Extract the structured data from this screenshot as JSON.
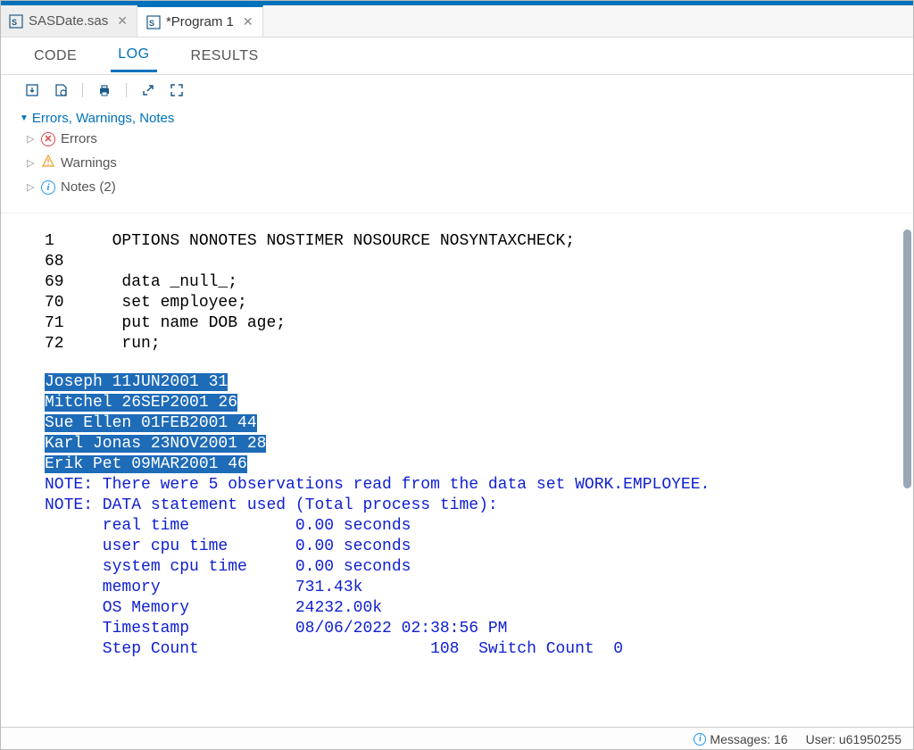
{
  "file_tabs": [
    {
      "label": "SASDate.sas",
      "active": false
    },
    {
      "label": "*Program 1",
      "active": true
    }
  ],
  "view_tabs": {
    "code": "CODE",
    "log": "LOG",
    "results": "RESULTS"
  },
  "filters": {
    "header": "Errors, Warnings, Notes",
    "errors": "Errors",
    "warnings": "Warnings",
    "notes": "Notes (2)"
  },
  "log_code_lines": [
    {
      "num": "1",
      "text": "OPTIONS NONOTES NOSTIMER NOSOURCE NOSYNTAXCHECK;"
    },
    {
      "num": "68",
      "text": ""
    },
    {
      "num": "69",
      "text": "data _null_;"
    },
    {
      "num": "70",
      "text": "set employee;"
    },
    {
      "num": "71",
      "text": "put name DOB age;"
    },
    {
      "num": "72",
      "text": "run;"
    }
  ],
  "log_highlight": [
    "Joseph 11JUN2001 31",
    "Mitchel 26SEP2001 26",
    "Sue Ellen 01FEB2001 44",
    "Karl Jonas 23NOV2001 28",
    "Erik Pet 09MAR2001 46"
  ],
  "log_notes": [
    "NOTE: There were 5 observations read from the data set WORK.EMPLOYEE.",
    "NOTE: DATA statement used (Total process time):",
    "      real time           0.00 seconds",
    "      user cpu time       0.00 seconds",
    "      system cpu time     0.00 seconds",
    "      memory              731.43k",
    "      OS Memory           24232.00k",
    "      Timestamp           08/06/2022 02:38:56 PM",
    "      Step Count                        108  Switch Count  0"
  ],
  "status": {
    "messages_label": "Messages: 16",
    "user_label": "User: u61950255"
  }
}
